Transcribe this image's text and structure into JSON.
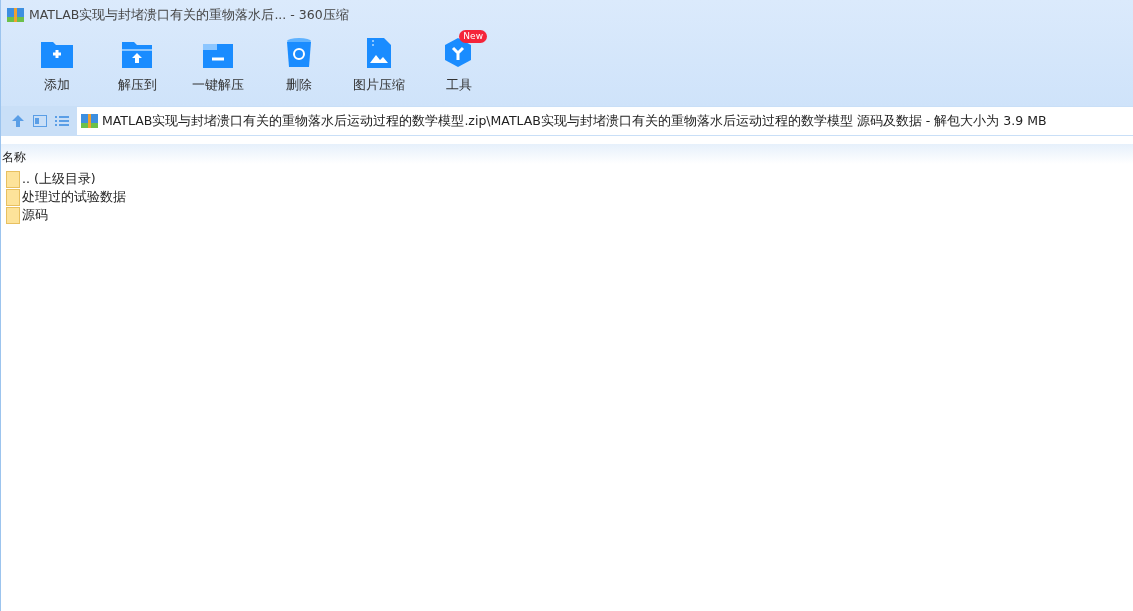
{
  "window": {
    "title": "MATLAB实现与封堵溃口有关的重物落水后... - 360压缩"
  },
  "toolbar": [
    {
      "kind": "add",
      "label": "添加"
    },
    {
      "kind": "extract",
      "label": "解压到"
    },
    {
      "kind": "oneclick",
      "label": "一键解压"
    },
    {
      "kind": "delete",
      "label": "删除"
    },
    {
      "kind": "image",
      "label": "图片压缩"
    },
    {
      "kind": "tools",
      "label": "工具",
      "badge": "New"
    }
  ],
  "address": {
    "path": "MATLAB实现与封堵溃口有关的重物落水后运动过程的数学模型.zip\\MATLAB实现与封堵溃口有关的重物落水后运动过程的数学模型 源码及数据 - 解包大小为 3.9 MB"
  },
  "file_list": {
    "columns": [
      "名称"
    ],
    "rows": [
      {
        "name": ".. (上级目录)"
      },
      {
        "name": "处理过的试验数据"
      },
      {
        "name": "源码"
      }
    ]
  }
}
